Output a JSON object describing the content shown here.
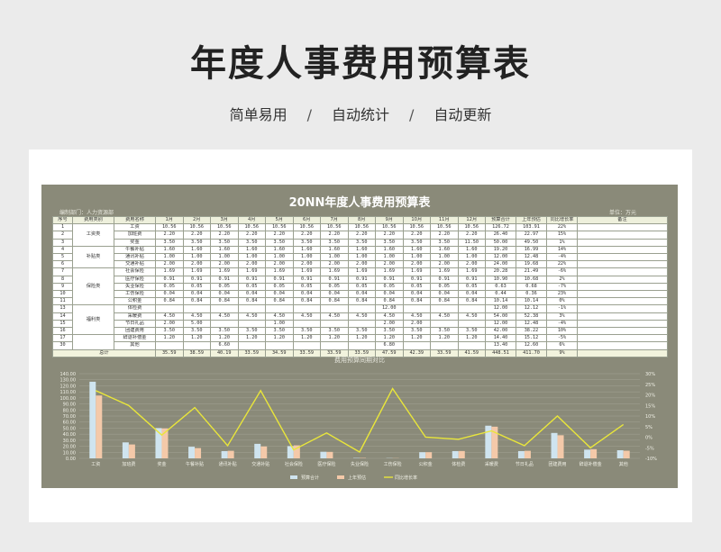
{
  "header": {
    "title": "年度人事费用预算表",
    "sub1": "简单易用",
    "sub2": "自动统计",
    "sub3": "自动更新",
    "sep": "/"
  },
  "sheet": {
    "title": "20NN年度人事费用预算表",
    "dept": "编制部门：人力资源部",
    "unit": "单位：万元",
    "columns": [
      "序号",
      "费用类别",
      "费用名称",
      "1月",
      "2月",
      "3月",
      "4月",
      "5月",
      "6月",
      "7月",
      "8月",
      "9月",
      "10月",
      "11月",
      "12月",
      "预算合计",
      "上年预估",
      "同比增长率",
      "备注"
    ],
    "rows": [
      {
        "no": "1",
        "cat": "",
        "name": "工资",
        "m": [
          "10.56",
          "10.56",
          "10.56",
          "10.56",
          "10.56",
          "10.56",
          "10.56",
          "10.56",
          "10.56",
          "10.56",
          "10.56",
          "10.56"
        ],
        "sum": "126.72",
        "prev": "103.91",
        "rate": "22%"
      },
      {
        "no": "2",
        "cat": "工资类",
        "name": "加班费",
        "m": [
          "2.20",
          "2.20",
          "2.20",
          "2.20",
          "2.20",
          "2.20",
          "2.20",
          "2.20",
          "2.20",
          "2.20",
          "2.20",
          "2.20"
        ],
        "sum": "26.40",
        "prev": "22.97",
        "rate": "15%"
      },
      {
        "no": "3",
        "cat": "",
        "name": "奖金",
        "m": [
          "3.50",
          "3.50",
          "3.50",
          "3.50",
          "3.50",
          "3.50",
          "3.50",
          "3.50",
          "3.50",
          "3.50",
          "3.50",
          "11.50"
        ],
        "sum": "50.00",
        "prev": "49.50",
        "rate": "1%"
      },
      {
        "no": "4",
        "cat": "",
        "name": "午餐补贴",
        "m": [
          "1.60",
          "1.60",
          "1.60",
          "1.60",
          "1.60",
          "1.60",
          "1.60",
          "1.60",
          "1.60",
          "1.60",
          "1.60",
          "1.60"
        ],
        "sum": "19.20",
        "prev": "16.99",
        "rate": "14%"
      },
      {
        "no": "5",
        "cat": "补贴类",
        "name": "通讯补贴",
        "m": [
          "1.00",
          "1.00",
          "1.00",
          "1.00",
          "1.00",
          "1.00",
          "1.00",
          "1.00",
          "1.00",
          "1.00",
          "1.00",
          "1.00"
        ],
        "sum": "12.00",
        "prev": "12.48",
        "rate": "-4%"
      },
      {
        "no": "6",
        "cat": "",
        "name": "交通补贴",
        "m": [
          "2.00",
          "2.00",
          "2.00",
          "2.00",
          "2.00",
          "2.00",
          "2.00",
          "2.00",
          "2.00",
          "2.00",
          "2.00",
          "2.00"
        ],
        "sum": "24.00",
        "prev": "19.68",
        "rate": "22%"
      },
      {
        "no": "7",
        "cat": "",
        "name": "社会保险",
        "m": [
          "1.69",
          "1.69",
          "1.69",
          "1.69",
          "1.69",
          "1.69",
          "1.69",
          "1.69",
          "1.69",
          "1.69",
          "1.69",
          "1.69"
        ],
        "sum": "20.28",
        "prev": "21.49",
        "rate": "-6%"
      },
      {
        "no": "8",
        "cat": "",
        "name": "医疗保险",
        "m": [
          "0.91",
          "0.91",
          "0.91",
          "0.91",
          "0.91",
          "0.91",
          "0.91",
          "0.91",
          "0.91",
          "0.91",
          "0.91",
          "0.91"
        ],
        "sum": "10.90",
        "prev": "10.68",
        "rate": "2%"
      },
      {
        "no": "9",
        "cat": "保险类",
        "name": "失业保险",
        "m": [
          "0.05",
          "0.05",
          "0.05",
          "0.05",
          "0.05",
          "0.05",
          "0.05",
          "0.05",
          "0.05",
          "0.05",
          "0.05",
          "0.05"
        ],
        "sum": "0.63",
        "prev": "0.68",
        "rate": "-7%"
      },
      {
        "no": "10",
        "cat": "",
        "name": "工伤保险",
        "m": [
          "0.04",
          "0.04",
          "0.04",
          "0.04",
          "0.04",
          "0.04",
          "0.04",
          "0.04",
          "0.04",
          "0.04",
          "0.04",
          "0.04"
        ],
        "sum": "0.44",
        "prev": "0.36",
        "rate": "23%"
      },
      {
        "no": "11",
        "cat": "",
        "name": "公积金",
        "m": [
          "0.84",
          "0.84",
          "0.84",
          "0.84",
          "0.84",
          "0.84",
          "0.84",
          "0.84",
          "0.84",
          "0.84",
          "0.84",
          "0.84"
        ],
        "sum": "10.14",
        "prev": "10.14",
        "rate": "0%"
      },
      {
        "no": "13",
        "cat": "",
        "name": "体检费",
        "m": [
          "",
          "",
          "",
          "",
          "",
          "",
          "",
          "",
          "12.00",
          "",
          "",
          ""
        ],
        "sum": "12.00",
        "prev": "12.12",
        "rate": "-1%"
      },
      {
        "no": "14",
        "cat": "福利类",
        "name": "采暖费",
        "m": [
          "4.50",
          "4.50",
          "4.50",
          "4.50",
          "4.50",
          "4.50",
          "4.50",
          "4.50",
          "4.50",
          "4.50",
          "4.50",
          "4.50"
        ],
        "sum": "54.00",
        "prev": "52.38",
        "rate": "3%"
      },
      {
        "no": "15",
        "cat": "",
        "name": "节日礼品",
        "m": [
          "2.00",
          "5.00",
          "",
          "",
          "1.00",
          "",
          "",
          "",
          "2.00",
          "2.00",
          "",
          ""
        ],
        "sum": "12.00",
        "prev": "12.48",
        "rate": "-4%"
      },
      {
        "no": "16",
        "cat": "",
        "name": "团建费用",
        "m": [
          "3.50",
          "3.50",
          "3.50",
          "3.50",
          "3.50",
          "3.50",
          "3.50",
          "3.50",
          "3.50",
          "3.50",
          "3.50",
          "3.50"
        ],
        "sum": "42.00",
        "prev": "38.22",
        "rate": "10%"
      },
      {
        "no": "17",
        "cat": "其他类",
        "name": "辞退补偿金",
        "m": [
          "1.20",
          "1.20",
          "1.20",
          "1.20",
          "1.20",
          "1.20",
          "1.20",
          "1.20",
          "1.20",
          "1.20",
          "1.20",
          "1.20"
        ],
        "sum": "14.40",
        "prev": "15.12",
        "rate": "-5%"
      },
      {
        "no": "30",
        "cat": "",
        "name": "其他",
        "m": [
          "",
          "",
          "6.60",
          "",
          "",
          "",
          "",
          "",
          "6.80",
          "",
          "",
          ""
        ],
        "sum": "13.40",
        "prev": "12.60",
        "rate": "6%"
      }
    ],
    "total": {
      "label": "总计",
      "m": [
        "35.59",
        "38.59",
        "40.19",
        "33.59",
        "34.59",
        "33.59",
        "33.59",
        "33.59",
        "47.59",
        "42.39",
        "33.59",
        "41.59"
      ],
      "sum": "448.51",
      "prev": "411.70",
      "rate": "9%"
    }
  },
  "chart_data": {
    "type": "bar",
    "title": "费用预算同期对比",
    "categories": [
      "工资",
      "加班费",
      "奖金",
      "午餐补贴",
      "通讯补贴",
      "交通补贴",
      "社会保险",
      "医疗保险",
      "失业保险",
      "工伤保险",
      "公积金",
      "体检费",
      "采暖费",
      "节日礼品",
      "团建费用",
      "辞退补偿金",
      "其他"
    ],
    "series": [
      {
        "name": "预算合计",
        "type": "bar",
        "axis": "left",
        "color": "#cfe4ef",
        "values": [
          126.72,
          26.4,
          50.0,
          19.2,
          12.0,
          24.0,
          20.28,
          10.9,
          0.63,
          0.44,
          10.14,
          12.0,
          54.0,
          12.0,
          42.0,
          14.4,
          13.4
        ]
      },
      {
        "name": "上年预估",
        "type": "bar",
        "axis": "left",
        "color": "#f4c9a9",
        "values": [
          103.91,
          22.97,
          49.5,
          16.99,
          12.48,
          19.68,
          21.49,
          10.68,
          0.68,
          0.36,
          10.14,
          12.12,
          52.38,
          12.48,
          38.22,
          15.12,
          12.6
        ]
      },
      {
        "name": "同比增长率",
        "type": "line",
        "axis": "right",
        "color": "#e9e63a",
        "values": [
          22,
          15,
          1,
          14,
          -4,
          22,
          -6,
          2,
          -7,
          23,
          0,
          -1,
          3,
          -4,
          10,
          -5,
          6
        ]
      }
    ],
    "yticks_left": [
      "0.00",
      "10.00",
      "20.00",
      "30.00",
      "40.00",
      "50.00",
      "60.00",
      "70.00",
      "80.00",
      "90.00",
      "100.00",
      "110.00",
      "120.00",
      "130.00",
      "140.00"
    ],
    "yticks_right": [
      "-10%",
      "-5%",
      "0%",
      "5%",
      "10%",
      "15%",
      "20%",
      "25%",
      "30%"
    ],
    "ylim_left": [
      0,
      140
    ],
    "ylim_right": [
      -10,
      30
    ],
    "legend_position": "bottom",
    "grid": true
  }
}
